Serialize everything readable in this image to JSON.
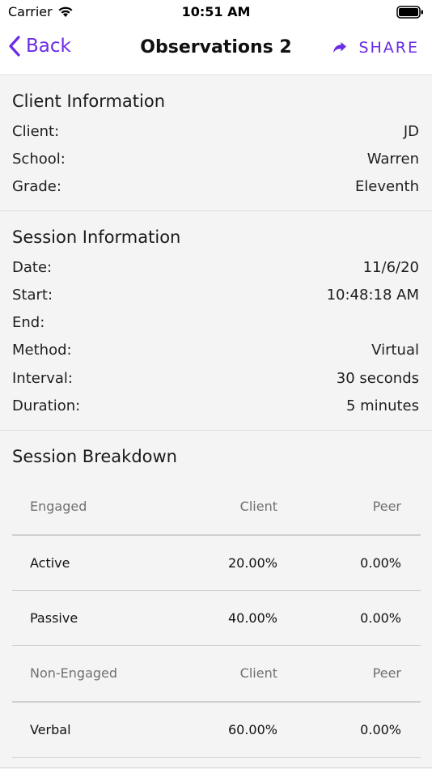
{
  "status_bar": {
    "carrier": "Carrier",
    "time": "10:51 AM"
  },
  "nav": {
    "back_label": "Back",
    "title": "Observations 2",
    "share_label": "SHARE"
  },
  "colors": {
    "accent": "#6a2be6"
  },
  "client_info": {
    "title": "Client Information",
    "rows": [
      {
        "label": "Client:",
        "value": "JD"
      },
      {
        "label": "School:",
        "value": "Warren"
      },
      {
        "label": "Grade:",
        "value": "Eleventh"
      }
    ]
  },
  "session_info": {
    "title": "Session Information",
    "rows": [
      {
        "label": "Date:",
        "value": "11/6/20"
      },
      {
        "label": "Start:",
        "value": "10:48:18 AM"
      },
      {
        "label": "End:",
        "value": ""
      },
      {
        "label": "Method:",
        "value": "Virtual"
      },
      {
        "label": "Interval:",
        "value": "30 seconds"
      },
      {
        "label": "Duration:",
        "value": "5 minutes"
      }
    ]
  },
  "breakdown": {
    "title": "Session Breakdown",
    "rows": [
      {
        "type": "header",
        "label": "Engaged",
        "client": "Client",
        "peer": "Peer"
      },
      {
        "type": "data",
        "label": "Active",
        "client": "20.00%",
        "peer": "0.00%"
      },
      {
        "type": "data",
        "label": "Passive",
        "client": "40.00%",
        "peer": "0.00%"
      },
      {
        "type": "header",
        "label": "Non-Engaged",
        "client": "Client",
        "peer": "Peer"
      },
      {
        "type": "data",
        "label": "Verbal",
        "client": "60.00%",
        "peer": "0.00%"
      }
    ]
  }
}
